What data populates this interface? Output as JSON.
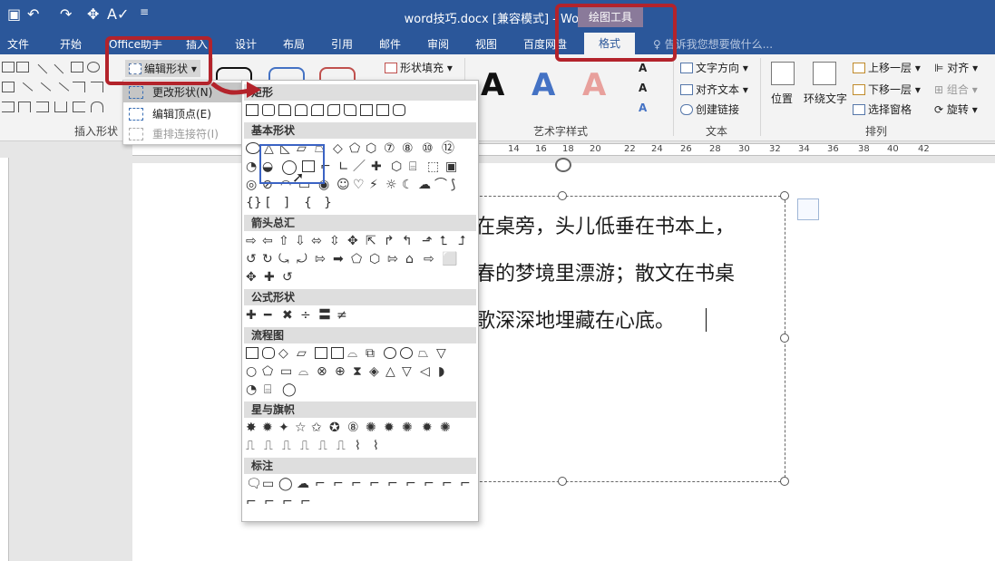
{
  "title_bar": {
    "doc_title": "word技巧.docx [兼容模式] - Word",
    "context_group": "绘图工具",
    "quick_access": [
      "save-icon",
      "undo-icon",
      "redo-icon",
      "touch-mode-icon",
      "format-painter-icon",
      "customize-icon"
    ]
  },
  "tabs": [
    "文件",
    "开始",
    "Office助手",
    "插入",
    "设计",
    "布局",
    "引用",
    "邮件",
    "审阅",
    "视图",
    "百度网盘",
    "格式"
  ],
  "tell_me": "告诉我您想要做什么...",
  "ribbon": {
    "insert_shapes": {
      "edit_shape_btn": "编辑形状",
      "label": "插入形状"
    },
    "shape_fill": "形状填充",
    "wordart_label": "艺术字样式",
    "text": {
      "direction": "文字方向",
      "align": "对齐文本",
      "link": "创建链接",
      "label": "文本"
    },
    "arrange": {
      "position": "位置",
      "wrap": "环绕文字",
      "bring_forward": "上移一层",
      "send_backward": "下移一层",
      "selection_pane": "选择窗格",
      "align": "对齐",
      "group": "组合",
      "rotate": "旋转",
      "label": "排列"
    }
  },
  "edit_menu": [
    "更改形状(N)",
    "编辑顶点(E)",
    "重排连接符(I)"
  ],
  "gallery": {
    "categories": [
      "矩形",
      "基本形状",
      "箭头总汇",
      "公式形状",
      "流程图",
      "星与旗帜",
      "标注"
    ]
  },
  "ruler_labels": [
    "2",
    "4",
    "6",
    "8",
    "10",
    "12",
    "14",
    "16",
    "18",
    "20",
    "22",
    "24",
    "26",
    "28",
    "30",
    "32",
    "34",
    "36",
    "38",
    "40",
    "42"
  ],
  "document": {
    "lines": [
      "在桌旁，头儿低垂在书本上，",
      "春的梦境里漂游；散文在书桌",
      "歌深深地埋藏在心底。"
    ]
  },
  "colors": {
    "accent": "#2b579a",
    "highlight_red": "#b3232b",
    "selection_blue": "#3b63c4"
  }
}
